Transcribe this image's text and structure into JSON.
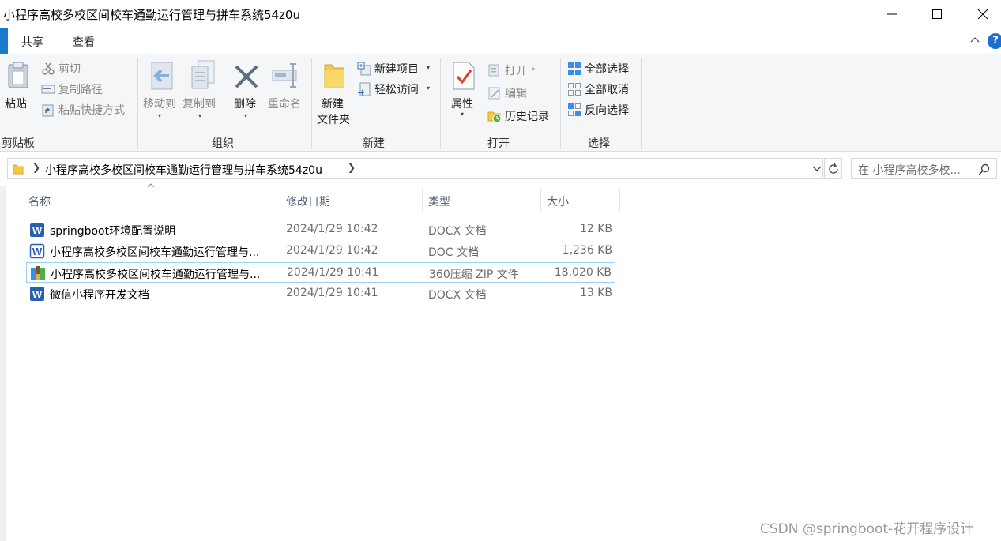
{
  "window": {
    "title": "小程序高校多校区间校车通勤运行管理与拼车系统54z0u"
  },
  "ribbon_tabs": {
    "share": "共享",
    "view": "查看"
  },
  "ribbon": {
    "clipboard": {
      "paste": "粘贴",
      "cut": "剪切",
      "copy_path": "复制路径",
      "paste_shortcut": "粘贴快捷方式",
      "label": "剪贴板"
    },
    "organize": {
      "move_to": "移动到",
      "copy_to": "复制到",
      "delete": "删除",
      "rename": "重命名",
      "label": "组织"
    },
    "new": {
      "new_folder_line1": "新建",
      "new_folder_line2": "文件夹",
      "new_item": "新建项目",
      "easy_access": "轻松访问",
      "label": "新建"
    },
    "open": {
      "properties": "属性",
      "open": "打开",
      "edit": "编辑",
      "history": "历史记录",
      "label": "打开"
    },
    "select": {
      "select_all": "全部选择",
      "select_none": "全部取消",
      "invert_selection": "反向选择",
      "label": "选择"
    }
  },
  "address": {
    "path": "小程序高校多校区间校车通勤运行管理与拼车系统54z0u",
    "search_placeholder": "在 小程序高校多校..."
  },
  "columns": {
    "name": "名称",
    "date": "修改日期",
    "type": "类型",
    "size": "大小"
  },
  "files": [
    {
      "name": "springboot环境配置说明",
      "date": "2024/1/29 10:42",
      "type": "DOCX 文档",
      "size": "12 KB",
      "icon": "word-docx-icon"
    },
    {
      "name": "小程序高校多校区间校车通勤运行管理与...",
      "date": "2024/1/29 10:42",
      "type": "DOC 文档",
      "size": "1,236 KB",
      "icon": "word-doc-icon"
    },
    {
      "name": "小程序高校多校区间校车通勤运行管理与...",
      "date": "2024/1/29 10:41",
      "type": "360压缩 ZIP 文件",
      "size": "18,020 KB",
      "icon": "zip-archive-icon"
    },
    {
      "name": "微信小程序开发文档",
      "date": "2024/1/29 10:41",
      "type": "DOCX 文档",
      "size": "13 KB",
      "icon": "word-docx-icon"
    }
  ],
  "watermark": "CSDN @springboot-花开程序设计",
  "colors": {
    "accent": "#1979ca",
    "selection_border": "#99d1ff",
    "column_header_text": "#4c607a",
    "word_blue": "#2b5fb4"
  }
}
